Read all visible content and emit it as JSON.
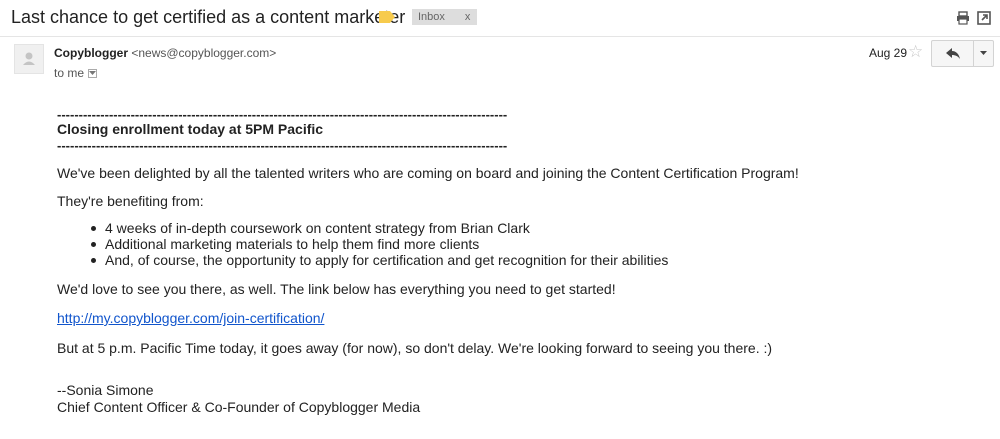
{
  "header": {
    "subject": "Last chance to get certified as a content marketer",
    "label_color": "#f7cb4d",
    "inbox_tag": "Inbox",
    "inbox_tag_close": "x",
    "icons": [
      "print-icon",
      "new-window-icon"
    ]
  },
  "message": {
    "sender_name": "Copyblogger",
    "sender_email": "<news@copyblogger.com>",
    "to_line": "to me",
    "date": "Aug 29",
    "star_glyph": "☆"
  },
  "email_body": {
    "dashes_top": "--------------------------------------------------------------------------------------------------------",
    "heading": "Closing enrollment today at 5PM Pacific",
    "dashes_bottom": "--------------------------------------------------------------------------------------------------------",
    "intro": "We've been delighted by all the talented writers who are coming on board and joining the Content Certification Program!",
    "benefits_lead": "They're benefiting from:",
    "benefits": [
      "4 weeks of in-depth coursework on content strategy from Brian Clark",
      "Additional marketing materials to help them find more clients",
      "And, of course, the opportunity to apply for certification and get recognition for their abilities"
    ],
    "invite": "We'd love to see you there, as well. The link below has everything you need to get started!",
    "link": "http://my.copyblogger.com/join-certification/",
    "deadline": "But at 5 p.m. Pacific Time today, it goes away (for now), so don't delay. We're looking forward to seeing you there. :)",
    "signature_name": "--Sonia Simone",
    "signature_title": "Chief Content Officer & Co-Founder of Copyblogger Media"
  }
}
